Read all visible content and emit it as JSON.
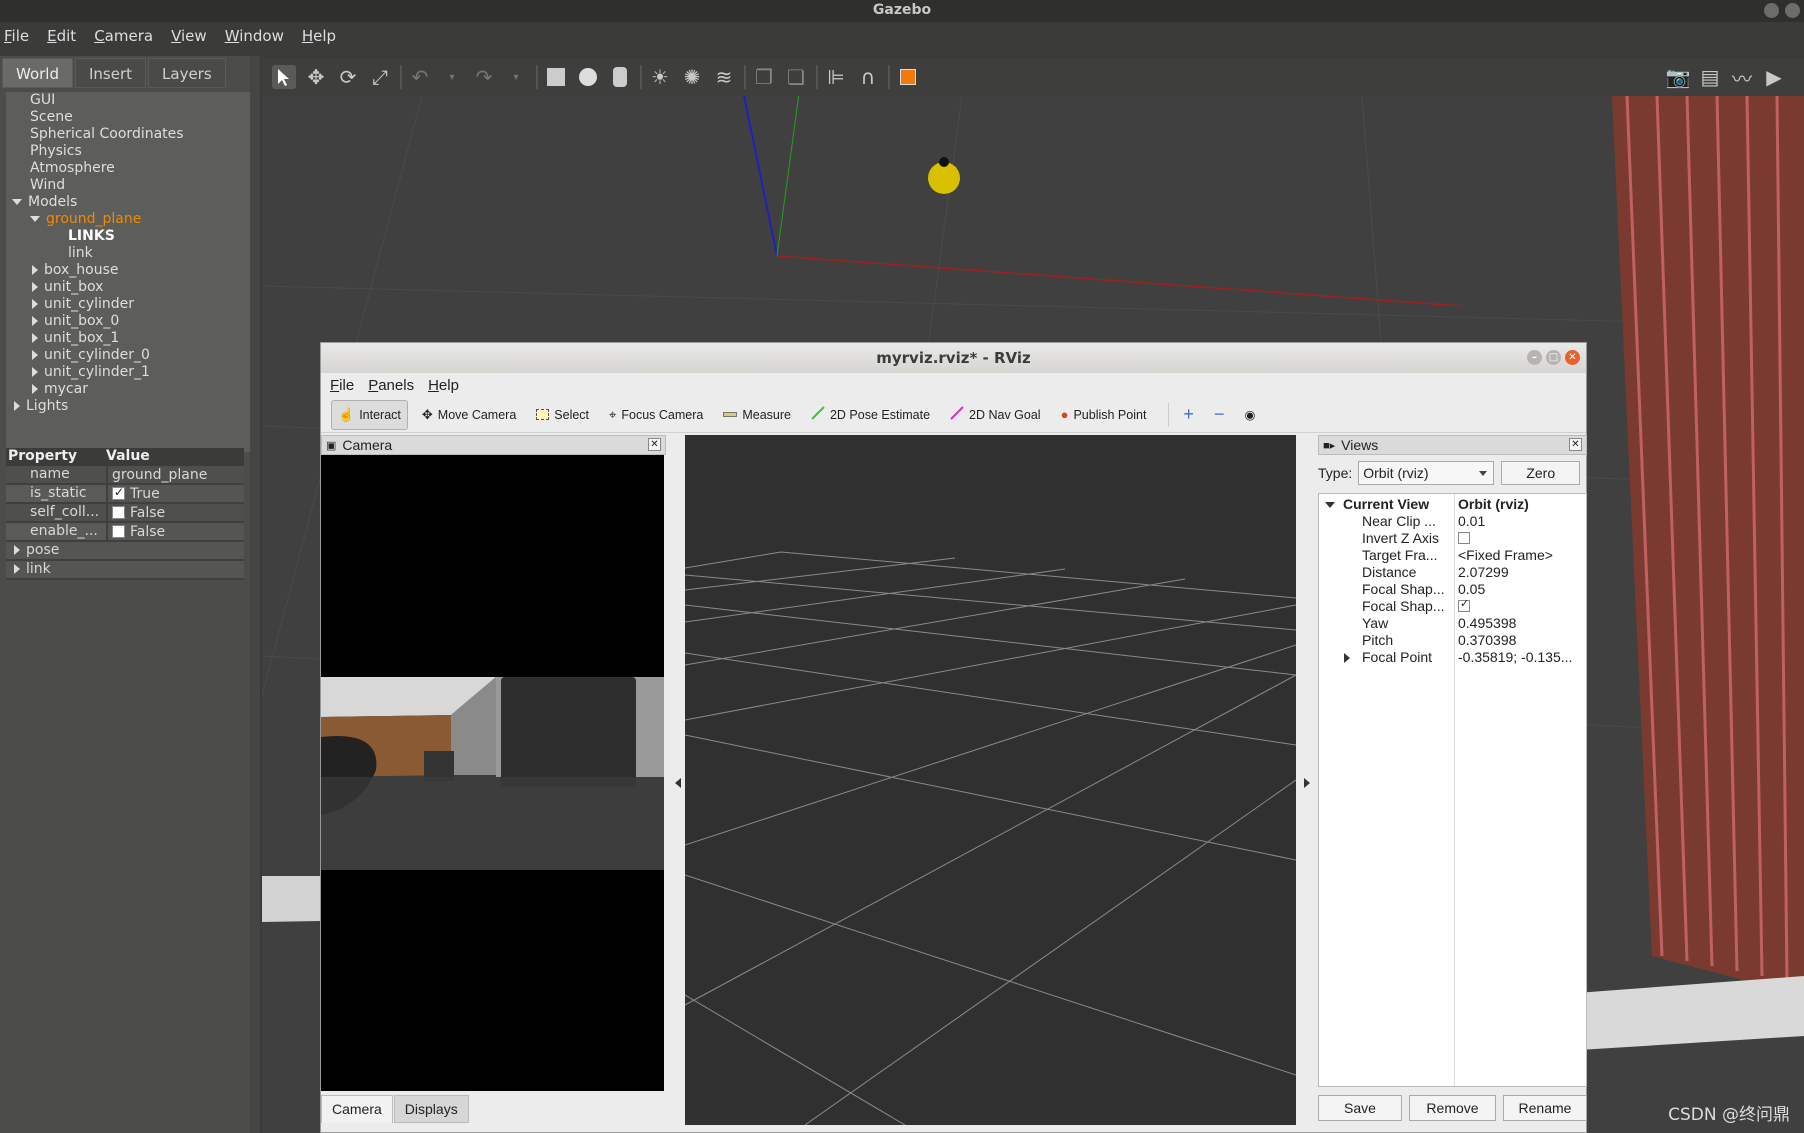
{
  "gazebo": {
    "title": "Gazebo",
    "menu": [
      "File",
      "Edit",
      "Camera",
      "View",
      "Window",
      "Help"
    ],
    "tabs": [
      "World",
      "Insert",
      "Layers"
    ],
    "tree": {
      "gui": "GUI",
      "scene": "Scene",
      "spherical": "Spherical Coordinates",
      "physics": "Physics",
      "atmosphere": "Atmosphere",
      "wind": "Wind",
      "models": "Models",
      "ground_plane": "ground_plane",
      "links_header": "LINKS",
      "link": "link",
      "box_house": "box_house",
      "unit_box": "unit_box",
      "unit_cylinder": "unit_cylinder",
      "unit_box_0": "unit_box_0",
      "unit_box_1": "unit_box_1",
      "unit_cylinder_0": "unit_cylinder_0",
      "unit_cylinder_1": "unit_cylinder_1",
      "mycar": "mycar",
      "lights": "Lights"
    },
    "props": {
      "col_property": "Property",
      "col_value": "Value",
      "name_key": "name",
      "name_val": "ground_plane",
      "static_key": "is_static",
      "static_val": "True",
      "selfcoll_key": "self_coll...",
      "selfcoll_val": "False",
      "enable_key": "enable_...",
      "enable_val": "False",
      "pose": "pose",
      "link": "link"
    }
  },
  "watermark": "CSDN @终问鼎",
  "rviz": {
    "title": "myrviz.rviz* - RViz",
    "menu": [
      "File",
      "Panels",
      "Help"
    ],
    "tools": {
      "interact": "Interact",
      "move_camera": "Move Camera",
      "select": "Select",
      "focus_camera": "Focus Camera",
      "measure": "Measure",
      "pose_estimate": "2D Pose Estimate",
      "nav_goal": "2D Nav Goal",
      "publish_point": "Publish Point"
    },
    "camera_panel_title": "Camera",
    "bottom_tabs": [
      "Camera",
      "Displays"
    ],
    "views": {
      "title": "Views",
      "type_label": "Type:",
      "type_value": "Orbit (rviz)",
      "zero": "Zero",
      "rows": [
        {
          "k": "Current View",
          "v": "Orbit (rviz)"
        },
        {
          "k": "Near Clip ...",
          "v": "0.01"
        },
        {
          "k": "Invert Z Axis",
          "v": ""
        },
        {
          "k": "Target Fra...",
          "v": "<Fixed Frame>"
        },
        {
          "k": "Distance",
          "v": "2.07299"
        },
        {
          "k": "Focal Shap...",
          "v": "0.05"
        },
        {
          "k": "Focal Shap...",
          "v": ""
        },
        {
          "k": "Yaw",
          "v": "0.495398"
        },
        {
          "k": "Pitch",
          "v": "0.370398"
        },
        {
          "k": "Focal Point",
          "v": "-0.35819; -0.135..."
        }
      ],
      "buttons": [
        "Save",
        "Remove",
        "Rename"
      ]
    }
  },
  "colors": {
    "selected_model": "#f08a00",
    "close_button": "#e8612c",
    "pose_estimate": "#33cc33",
    "nav_goal": "#cc33cc",
    "publish_point": "#d04a1a"
  }
}
